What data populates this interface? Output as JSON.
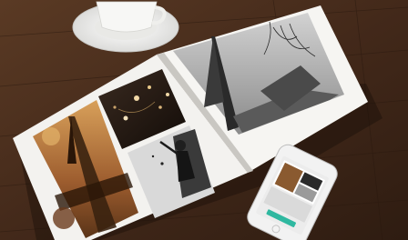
{
  "scene": {
    "photo_book": {
      "right_page_caption_lines": [
        "",
        ""
      ]
    },
    "phone": {
      "app_name": "",
      "accent_color": "#2fb8a0"
    }
  },
  "colors": {
    "table": "#4a2e1c",
    "page": "#f3f2ef",
    "cup": "#f4f4f2"
  }
}
